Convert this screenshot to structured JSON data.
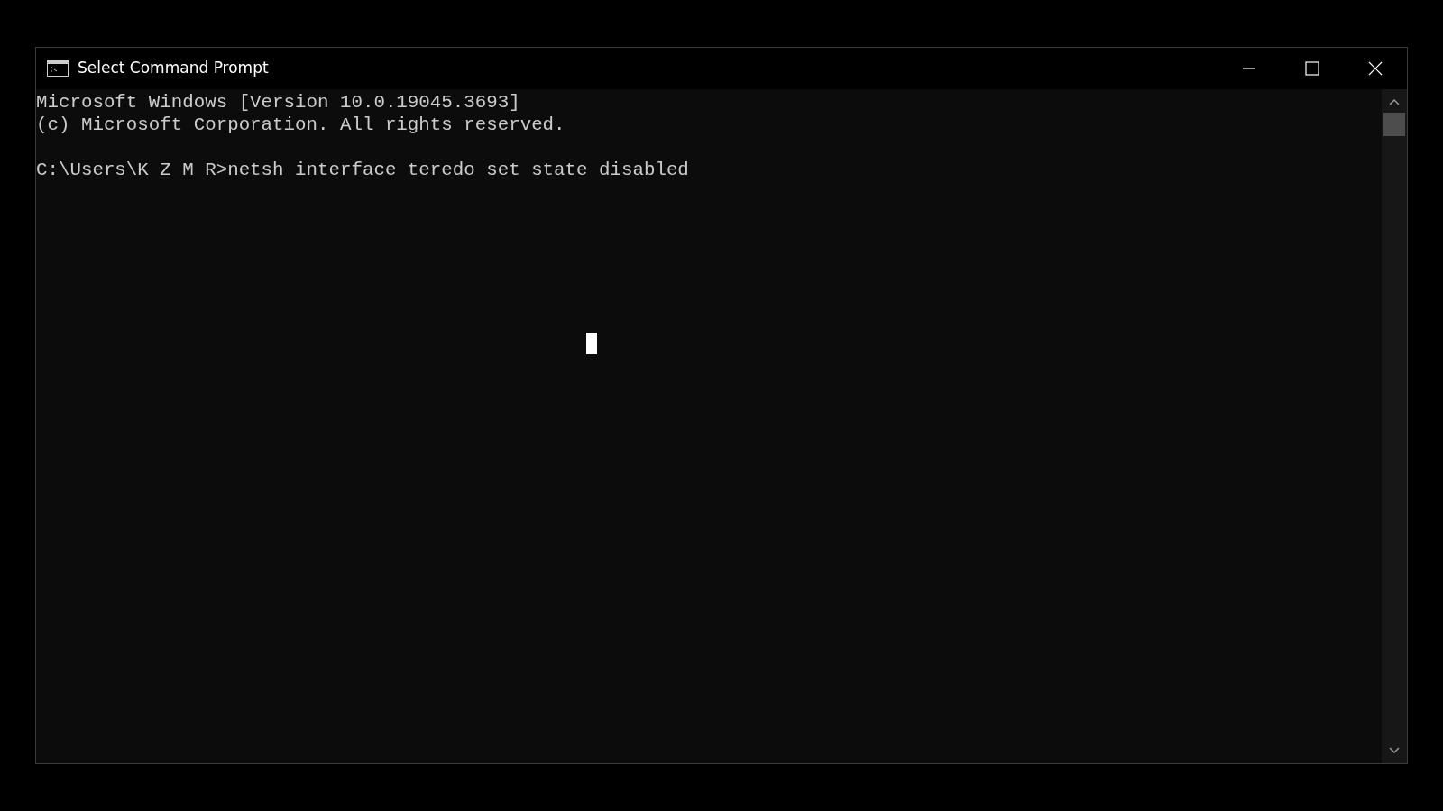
{
  "window": {
    "title": "Select Command Prompt"
  },
  "console": {
    "blocks": [
      {
        "lines": [
          "Microsoft Windows [Version 10.0.19045.3693]",
          "(c) Microsoft Corporation. All rights reserved."
        ]
      },
      {
        "lines": [
          "C:\\Users\\K Z M R>netsh interface teredo set state disabled"
        ]
      }
    ]
  }
}
